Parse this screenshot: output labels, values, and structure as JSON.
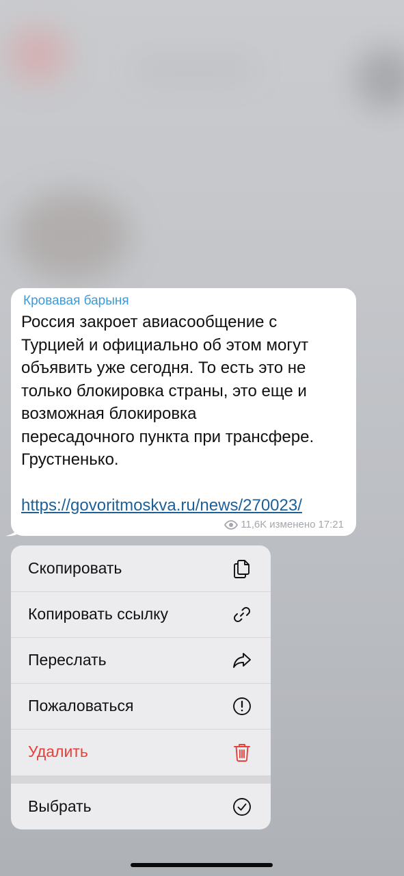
{
  "message": {
    "sender": "Кровавая барыня",
    "text": "Россия закроет авиасообщение с\nТурцией и официально об этом могут\nобъявить уже сегодня. То есть это не\nтолько блокировка страны, это еще и\nвозможная блокировка\nпересадочного пункта при трансфере.\nГрустненько.",
    "link": "https://govoritmoskva.ru/news/270023/",
    "views": "11,6K",
    "edited_label": "изменено",
    "time": "17:21"
  },
  "menu": {
    "items": [
      {
        "label": "Скопировать",
        "icon": "copy-icon"
      },
      {
        "label": "Копировать ссылку",
        "icon": "link-icon"
      },
      {
        "label": "Переслать",
        "icon": "forward-icon"
      },
      {
        "label": "Пожаловаться",
        "icon": "report-icon"
      },
      {
        "label": "Удалить",
        "icon": "trash-icon",
        "color": "#e64139"
      },
      {
        "label": "Выбрать",
        "icon": "checkmark-circle-icon"
      }
    ]
  },
  "colors": {
    "sender": "#3b9ad8",
    "link": "#1d5f97",
    "danger": "#e64139"
  }
}
